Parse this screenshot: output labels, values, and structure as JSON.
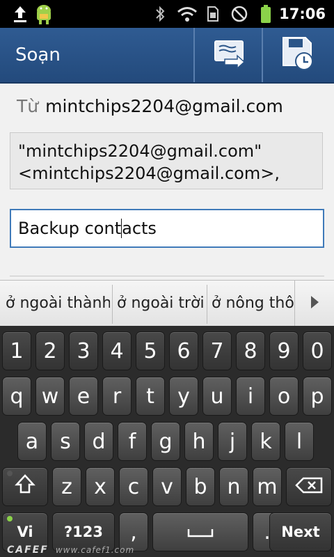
{
  "status_bar": {
    "time": "17:06",
    "icons": [
      "upload-icon",
      "android-icon",
      "bluetooth-icon",
      "wifi-icon",
      "sim-icon",
      "do-not-disturb-icon",
      "battery-icon"
    ]
  },
  "action_bar": {
    "title": "Soạn",
    "actions": [
      "send-icon",
      "save-draft-icon"
    ]
  },
  "compose": {
    "from_label": "Từ",
    "from_value": "mintchips2204@gmail.com",
    "to_line1": "\"mintchips2204@gmail.com\"",
    "to_line2": "<mintchips2204@gmail.com>,",
    "subject_before_caret": "Backup cont",
    "subject_after_caret": "acts"
  },
  "suggestions": [
    "ở ngoài thành",
    "ở ngoài trời",
    "ở nông thôn"
  ],
  "keyboard": {
    "row_numbers": [
      "1",
      "2",
      "3",
      "4",
      "5",
      "6",
      "7",
      "8",
      "9",
      "0"
    ],
    "row_top": [
      "q",
      "w",
      "e",
      "r",
      "t",
      "y",
      "u",
      "i",
      "o",
      "p"
    ],
    "row_mid": [
      "a",
      "s",
      "d",
      "f",
      "g",
      "h",
      "j",
      "k",
      "l"
    ],
    "row_bottom": [
      "z",
      "x",
      "c",
      "v",
      "b",
      "n",
      "m"
    ],
    "lang_label": "Vi",
    "symbols_label": "?123",
    "comma_label": ",",
    "period_label": ".",
    "next_label": "Next"
  },
  "watermark": {
    "brand": "CAFEF",
    "url": "www.cafef1.com"
  },
  "colors": {
    "action_bar": "#2b5588",
    "subject_focus": "#3f7ab9",
    "dot_green": "#8bd24a"
  }
}
